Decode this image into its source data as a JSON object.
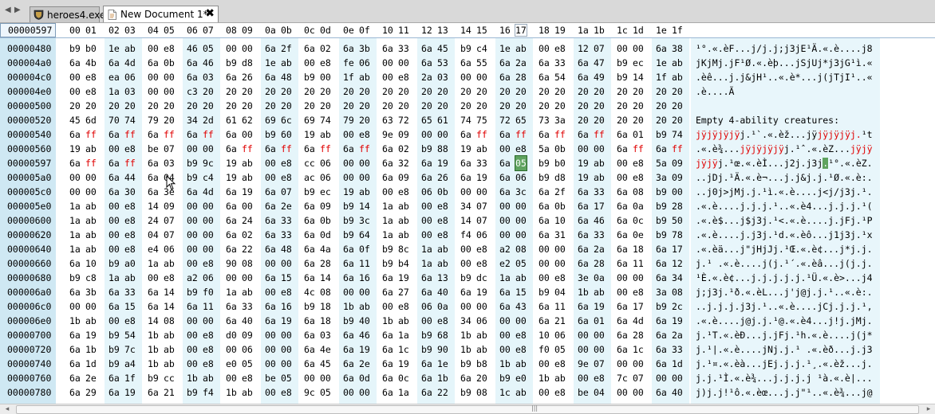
{
  "tabs": [
    {
      "label": "heroes4.exe",
      "active": false,
      "icon": "shield-app-icon"
    },
    {
      "label": "New Document 1*",
      "active": true,
      "icon": "document-icon"
    }
  ],
  "close_glyph": "✖",
  "nav_arrows": {
    "left": "◀",
    "right": "▶"
  },
  "header": {
    "current_address": "00000597",
    "columns": [
      "00",
      "01",
      "02",
      "03",
      "04",
      "05",
      "06",
      "07",
      "08",
      "09",
      "0a",
      "0b",
      "0c",
      "0d",
      "0e",
      "0f",
      "10",
      "11",
      "12",
      "13",
      "14",
      "15",
      "16",
      "17",
      "18",
      "19",
      "1a",
      "1b",
      "1c",
      "1d",
      "1e",
      "1f"
    ],
    "current_column": "17"
  },
  "rows": [
    {
      "addr": "00000480",
      "bytes": [
        "b9",
        "b0",
        "1e",
        "ab",
        "00",
        "e8",
        "46",
        "05",
        "00",
        "00",
        "6a",
        "2f",
        "6a",
        "02",
        "6a",
        "3b",
        "6a",
        "33",
        "6a",
        "45",
        "b9",
        "c4",
        "1e",
        "ab",
        "00",
        "e8",
        "12",
        "07",
        "00",
        "00",
        "6a",
        "38"
      ],
      "ascii": "¹°.«.èF...j/j.j;j3jE¹Ä.«.è....j8"
    },
    {
      "addr": "000004a0",
      "bytes": [
        "6a",
        "4b",
        "6a",
        "4d",
        "6a",
        "0b",
        "6a",
        "46",
        "b9",
        "d8",
        "1e",
        "ab",
        "00",
        "e8",
        "fe",
        "06",
        "00",
        "00",
        "6a",
        "53",
        "6a",
        "55",
        "6a",
        "2a",
        "6a",
        "33",
        "6a",
        "47",
        "b9",
        "ec",
        "1e",
        "ab"
      ],
      "ascii": "jKjMj.jF¹Ø.«.èþ...jSjUj*j3jG¹ì.«"
    },
    {
      "addr": "000004c0",
      "bytes": [
        "00",
        "e8",
        "ea",
        "06",
        "00",
        "00",
        "6a",
        "03",
        "6a",
        "26",
        "6a",
        "48",
        "b9",
        "00",
        "1f",
        "ab",
        "00",
        "e8",
        "2a",
        "03",
        "00",
        "00",
        "6a",
        "28",
        "6a",
        "54",
        "6a",
        "49",
        "b9",
        "14",
        "1f",
        "ab"
      ],
      "ascii": ".èê...j.j&jH¹..«.è*...j(jTjI¹..«"
    },
    {
      "addr": "000004e0",
      "bytes": [
        "00",
        "e8",
        "1a",
        "03",
        "00",
        "00",
        "c3",
        "20",
        "20",
        "20",
        "20",
        "20",
        "20",
        "20",
        "20",
        "20",
        "20",
        "20",
        "20",
        "20",
        "20",
        "20",
        "20",
        "20",
        "20",
        "20",
        "20",
        "20",
        "20",
        "20",
        "20",
        "20"
      ],
      "ascii": ".è....Ã"
    },
    {
      "addr": "00000500",
      "bytes": [
        "20",
        "20",
        "20",
        "20",
        "20",
        "20",
        "20",
        "20",
        "20",
        "20",
        "20",
        "20",
        "20",
        "20",
        "20",
        "20",
        "20",
        "20",
        "20",
        "20",
        "20",
        "20",
        "20",
        "20",
        "20",
        "20",
        "20",
        "20",
        "20",
        "20",
        "20",
        "20"
      ],
      "ascii": ""
    },
    {
      "addr": "00000520",
      "bytes": [
        "45",
        "6d",
        "70",
        "74",
        "79",
        "20",
        "34",
        "2d",
        "61",
        "62",
        "69",
        "6c",
        "69",
        "74",
        "79",
        "20",
        "63",
        "72",
        "65",
        "61",
        "74",
        "75",
        "72",
        "65",
        "73",
        "3a",
        "20",
        "20",
        "20",
        "20",
        "20",
        "20"
      ],
      "ascii": "Empty 4-ability creatures:"
    },
    {
      "addr": "00000540",
      "bytes": [
        "6a",
        "ff",
        "6a",
        "ff",
        "6a",
        "ff",
        "6a",
        "ff",
        "6a",
        "00",
        "b9",
        "60",
        "19",
        "ab",
        "00",
        "e8",
        "9e",
        "09",
        "00",
        "00",
        "6a",
        "ff",
        "6a",
        "ff",
        "6a",
        "ff",
        "6a",
        "ff",
        "6a",
        "01",
        "b9",
        "74"
      ],
      "ascii": "jÿjÿjÿjÿj.¹`.«.èž...jÿjÿjÿjÿj.¹t",
      "red": [
        1,
        3,
        5,
        7,
        21,
        23,
        25,
        27
      ],
      "ascii_red": [
        [
          0,
          8
        ],
        [
          22,
          30
        ]
      ]
    },
    {
      "addr": "00000560",
      "bytes": [
        "19",
        "ab",
        "00",
        "e8",
        "be",
        "07",
        "00",
        "00",
        "6a",
        "ff",
        "6a",
        "ff",
        "6a",
        "ff",
        "6a",
        "ff",
        "6a",
        "02",
        "b9",
        "88",
        "19",
        "ab",
        "00",
        "e8",
        "5a",
        "0b",
        "00",
        "00",
        "6a",
        "ff",
        "6a",
        "ff"
      ],
      "ascii": ".«.è¾...jÿjÿjÿjÿj.¹ˆ.«.èZ...jÿjÿ",
      "red": [
        9,
        11,
        13,
        15,
        29,
        31
      ],
      "ascii_red": [
        [
          8,
          16
        ],
        [
          28,
          32
        ]
      ]
    },
    {
      "addr": "00000597",
      "bytes": [
        "6a",
        "ff",
        "6a",
        "ff",
        "6a",
        "03",
        "b9",
        "9c",
        "19",
        "ab",
        "00",
        "e8",
        "cc",
        "06",
        "00",
        "00",
        "6a",
        "32",
        "6a",
        "19",
        "6a",
        "33",
        "6a",
        "05",
        "b9",
        "b0",
        "19",
        "ab",
        "00",
        "e8",
        "5a",
        "09"
      ],
      "ascii": "jÿjÿj.¹œ.«.èÌ...j2j.j3j.¹°.«.èZ.",
      "red": [
        1,
        3
      ],
      "sel": 23,
      "ascii_red": [
        [
          0,
          4
        ]
      ],
      "ascii_sel": 23
    },
    {
      "addr": "000005a0",
      "bytes": [
        "00",
        "00",
        "6a",
        "44",
        "6a",
        "04",
        "b9",
        "c4",
        "19",
        "ab",
        "00",
        "e8",
        "ac",
        "06",
        "00",
        "00",
        "6a",
        "09",
        "6a",
        "26",
        "6a",
        "19",
        "6a",
        "06",
        "b9",
        "d8",
        "19",
        "ab",
        "00",
        "e8",
        "3a",
        "09"
      ],
      "ascii": "..jDj.¹Ä.«.è¬...j.j&j.j.¹Ø.«.è:."
    },
    {
      "addr": "000005c0",
      "bytes": [
        "00",
        "00",
        "6a",
        "30",
        "6a",
        "3e",
        "6a",
        "4d",
        "6a",
        "19",
        "6a",
        "07",
        "b9",
        "ec",
        "19",
        "ab",
        "00",
        "e8",
        "06",
        "0b",
        "00",
        "00",
        "6a",
        "3c",
        "6a",
        "2f",
        "6a",
        "33",
        "6a",
        "08",
        "b9",
        "00"
      ],
      "ascii": "..j0j>jMj.j.¹ì.«.è....j<j/j3j.¹."
    },
    {
      "addr": "000005e0",
      "bytes": [
        "1a",
        "ab",
        "00",
        "e8",
        "14",
        "09",
        "00",
        "00",
        "6a",
        "00",
        "6a",
        "2e",
        "6a",
        "09",
        "b9",
        "14",
        "1a",
        "ab",
        "00",
        "e8",
        "34",
        "07",
        "00",
        "00",
        "6a",
        "0b",
        "6a",
        "17",
        "6a",
        "0a",
        "b9",
        "28"
      ],
      "ascii": ".«.è....j.j.j.¹..«.è4...j.j.j.¹("
    },
    {
      "addr": "00000600",
      "bytes": [
        "1a",
        "ab",
        "00",
        "e8",
        "24",
        "07",
        "00",
        "00",
        "6a",
        "24",
        "6a",
        "33",
        "6a",
        "0b",
        "b9",
        "3c",
        "1a",
        "ab",
        "00",
        "e8",
        "14",
        "07",
        "00",
        "00",
        "6a",
        "10",
        "6a",
        "46",
        "6a",
        "0c",
        "b9",
        "50"
      ],
      "ascii": ".«.è$...j$j3j.¹<.«.è....j.jFj.¹P"
    },
    {
      "addr": "00000620",
      "bytes": [
        "1a",
        "ab",
        "00",
        "e8",
        "04",
        "07",
        "00",
        "00",
        "6a",
        "02",
        "6a",
        "33",
        "6a",
        "0d",
        "b9",
        "64",
        "1a",
        "ab",
        "00",
        "e8",
        "f4",
        "06",
        "00",
        "00",
        "6a",
        "31",
        "6a",
        "33",
        "6a",
        "0e",
        "b9",
        "78"
      ],
      "ascii": ".«.è....j.j3j.¹d.«.èô...j1j3j.¹x"
    },
    {
      "addr": "00000640",
      "bytes": [
        "1a",
        "ab",
        "00",
        "e8",
        "e4",
        "06",
        "00",
        "00",
        "6a",
        "22",
        "6a",
        "48",
        "6a",
        "4a",
        "6a",
        "0f",
        "b9",
        "8c",
        "1a",
        "ab",
        "00",
        "e8",
        "a2",
        "08",
        "00",
        "00",
        "6a",
        "2a",
        "6a",
        "18",
        "6a",
        "17"
      ],
      "ascii": ".«.èä...j\"jHjJj.¹Œ.«.è¢...j*j.j."
    },
    {
      "addr": "00000660",
      "bytes": [
        "6a",
        "10",
        "b9",
        "a0",
        "1a",
        "ab",
        "00",
        "e8",
        "90",
        "08",
        "00",
        "00",
        "6a",
        "28",
        "6a",
        "11",
        "b9",
        "b4",
        "1a",
        "ab",
        "00",
        "e8",
        "e2",
        "05",
        "00",
        "00",
        "6a",
        "28",
        "6a",
        "11",
        "6a",
        "12"
      ],
      "ascii": "j.¹ .«.è....j(j.¹´.«.èâ...j(j.j."
    },
    {
      "addr": "00000680",
      "bytes": [
        "b9",
        "c8",
        "1a",
        "ab",
        "00",
        "e8",
        "a2",
        "06",
        "00",
        "00",
        "6a",
        "15",
        "6a",
        "14",
        "6a",
        "16",
        "6a",
        "19",
        "6a",
        "13",
        "b9",
        "dc",
        "1a",
        "ab",
        "00",
        "e8",
        "3e",
        "0a",
        "00",
        "00",
        "6a",
        "34"
      ],
      "ascii": "¹È.«.è¢...j.j.j.j.j.¹Ü.«.è>...j4"
    },
    {
      "addr": "000006a0",
      "bytes": [
        "6a",
        "3b",
        "6a",
        "33",
        "6a",
        "14",
        "b9",
        "f0",
        "1a",
        "ab",
        "00",
        "e8",
        "4c",
        "08",
        "00",
        "00",
        "6a",
        "27",
        "6a",
        "40",
        "6a",
        "19",
        "6a",
        "15",
        "b9",
        "04",
        "1b",
        "ab",
        "00",
        "e8",
        "3a",
        "08"
      ],
      "ascii": "j;j3j.¹ð.«.èL...j'j@j.j.¹..«.è:."
    },
    {
      "addr": "000006c0",
      "bytes": [
        "00",
        "00",
        "6a",
        "15",
        "6a",
        "14",
        "6a",
        "11",
        "6a",
        "33",
        "6a",
        "16",
        "b9",
        "18",
        "1b",
        "ab",
        "00",
        "e8",
        "06",
        "0a",
        "00",
        "00",
        "6a",
        "43",
        "6a",
        "11",
        "6a",
        "19",
        "6a",
        "17",
        "b9",
        "2c"
      ],
      "ascii": "..j.j.j.j3j.¹..«.è....jCj.j.j.¹,"
    },
    {
      "addr": "000006e0",
      "bytes": [
        "1b",
        "ab",
        "00",
        "e8",
        "14",
        "08",
        "00",
        "00",
        "6a",
        "40",
        "6a",
        "19",
        "6a",
        "18",
        "b9",
        "40",
        "1b",
        "ab",
        "00",
        "e8",
        "34",
        "06",
        "00",
        "00",
        "6a",
        "21",
        "6a",
        "01",
        "6a",
        "4d",
        "6a",
        "19"
      ],
      "ascii": ".«.è....j@j.j.¹@.«.è4...j!j.jMj."
    },
    {
      "addr": "00000700",
      "bytes": [
        "6a",
        "19",
        "b9",
        "54",
        "1b",
        "ab",
        "00",
        "e8",
        "d0",
        "09",
        "00",
        "00",
        "6a",
        "03",
        "6a",
        "46",
        "6a",
        "1a",
        "b9",
        "68",
        "1b",
        "ab",
        "00",
        "e8",
        "10",
        "06",
        "00",
        "00",
        "6a",
        "28",
        "6a",
        "2a"
      ],
      "ascii": "j.¹T.«.èÐ...j.jFj.¹h.«.è....j(j*"
    },
    {
      "addr": "00000720",
      "bytes": [
        "6a",
        "1b",
        "b9",
        "7c",
        "1b",
        "ab",
        "00",
        "e8",
        "00",
        "06",
        "00",
        "00",
        "6a",
        "4e",
        "6a",
        "19",
        "6a",
        "1c",
        "b9",
        "90",
        "1b",
        "ab",
        "00",
        "e8",
        "f0",
        "05",
        "00",
        "00",
        "6a",
        "1c",
        "6a",
        "33"
      ],
      "ascii": "j.¹|.«.è....jNj.j.¹ .«.èð...j.j3"
    },
    {
      "addr": "00000740",
      "bytes": [
        "6a",
        "1d",
        "b9",
        "a4",
        "1b",
        "ab",
        "00",
        "e8",
        "e0",
        "05",
        "00",
        "00",
        "6a",
        "45",
        "6a",
        "2e",
        "6a",
        "19",
        "6a",
        "1e",
        "b9",
        "b8",
        "1b",
        "ab",
        "00",
        "e8",
        "9e",
        "07",
        "00",
        "00",
        "6a",
        "1d"
      ],
      "ascii": "j.¹¤.«.èà...jEj.j.j.¹¸.«.èž...j."
    },
    {
      "addr": "00000760",
      "bytes": [
        "6a",
        "2e",
        "6a",
        "1f",
        "b9",
        "cc",
        "1b",
        "ab",
        "00",
        "e8",
        "be",
        "05",
        "00",
        "00",
        "6a",
        "0d",
        "6a",
        "0c",
        "6a",
        "1b",
        "6a",
        "20",
        "b9",
        "e0",
        "1b",
        "ab",
        "00",
        "e8",
        "7c",
        "07",
        "00",
        "00"
      ],
      "ascii": "j.j.¹Ì.«.è¾...j.j.j.j ¹à.«.è|..."
    },
    {
      "addr": "00000780",
      "bytes": [
        "6a",
        "29",
        "6a",
        "19",
        "6a",
        "21",
        "b9",
        "f4",
        "1b",
        "ab",
        "00",
        "e8",
        "9c",
        "05",
        "00",
        "00",
        "6a",
        "1a",
        "6a",
        "22",
        "b9",
        "08",
        "1c",
        "ab",
        "00",
        "e8",
        "be",
        "04",
        "00",
        "00",
        "6a",
        "40"
      ],
      "ascii": "j)j.j!¹ô.«.èœ...j.j\"¹..«.è¾...j@"
    }
  ],
  "scroll_grip": "|||",
  "colors": {
    "selection": "#5fa35f",
    "highlight_text": "#e00000",
    "address_bg": "#cfe8f3"
  }
}
